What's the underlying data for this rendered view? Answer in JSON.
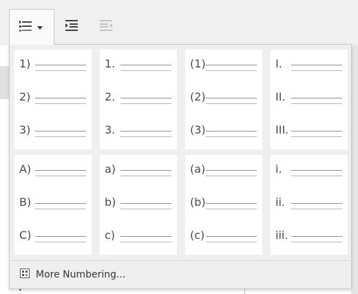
{
  "toolbar": {
    "buttons": [
      {
        "name": "toggle-ordered-list",
        "icon": "ordered-list-icon"
      },
      {
        "name": "increase-indent",
        "icon": "increase-indent-icon"
      },
      {
        "name": "decrease-indent",
        "icon": "decrease-indent-icon",
        "disabled": true
      }
    ]
  },
  "numbering_presets": [
    [
      "1)",
      "2)",
      "3)"
    ],
    [
      "1.",
      "2.",
      "3."
    ],
    [
      "(1)",
      "(2)",
      "(3)"
    ],
    [
      "I.",
      "II.",
      "III."
    ],
    [
      "A)",
      "B)",
      "C)"
    ],
    [
      "a)",
      "b)",
      "c)"
    ],
    [
      "(a)",
      "(b)",
      "(c)"
    ],
    [
      "i.",
      "ii.",
      "iii."
    ]
  ],
  "more_numbering": {
    "label": "More Numbering...",
    "icon": "numbering-dialog-icon"
  }
}
